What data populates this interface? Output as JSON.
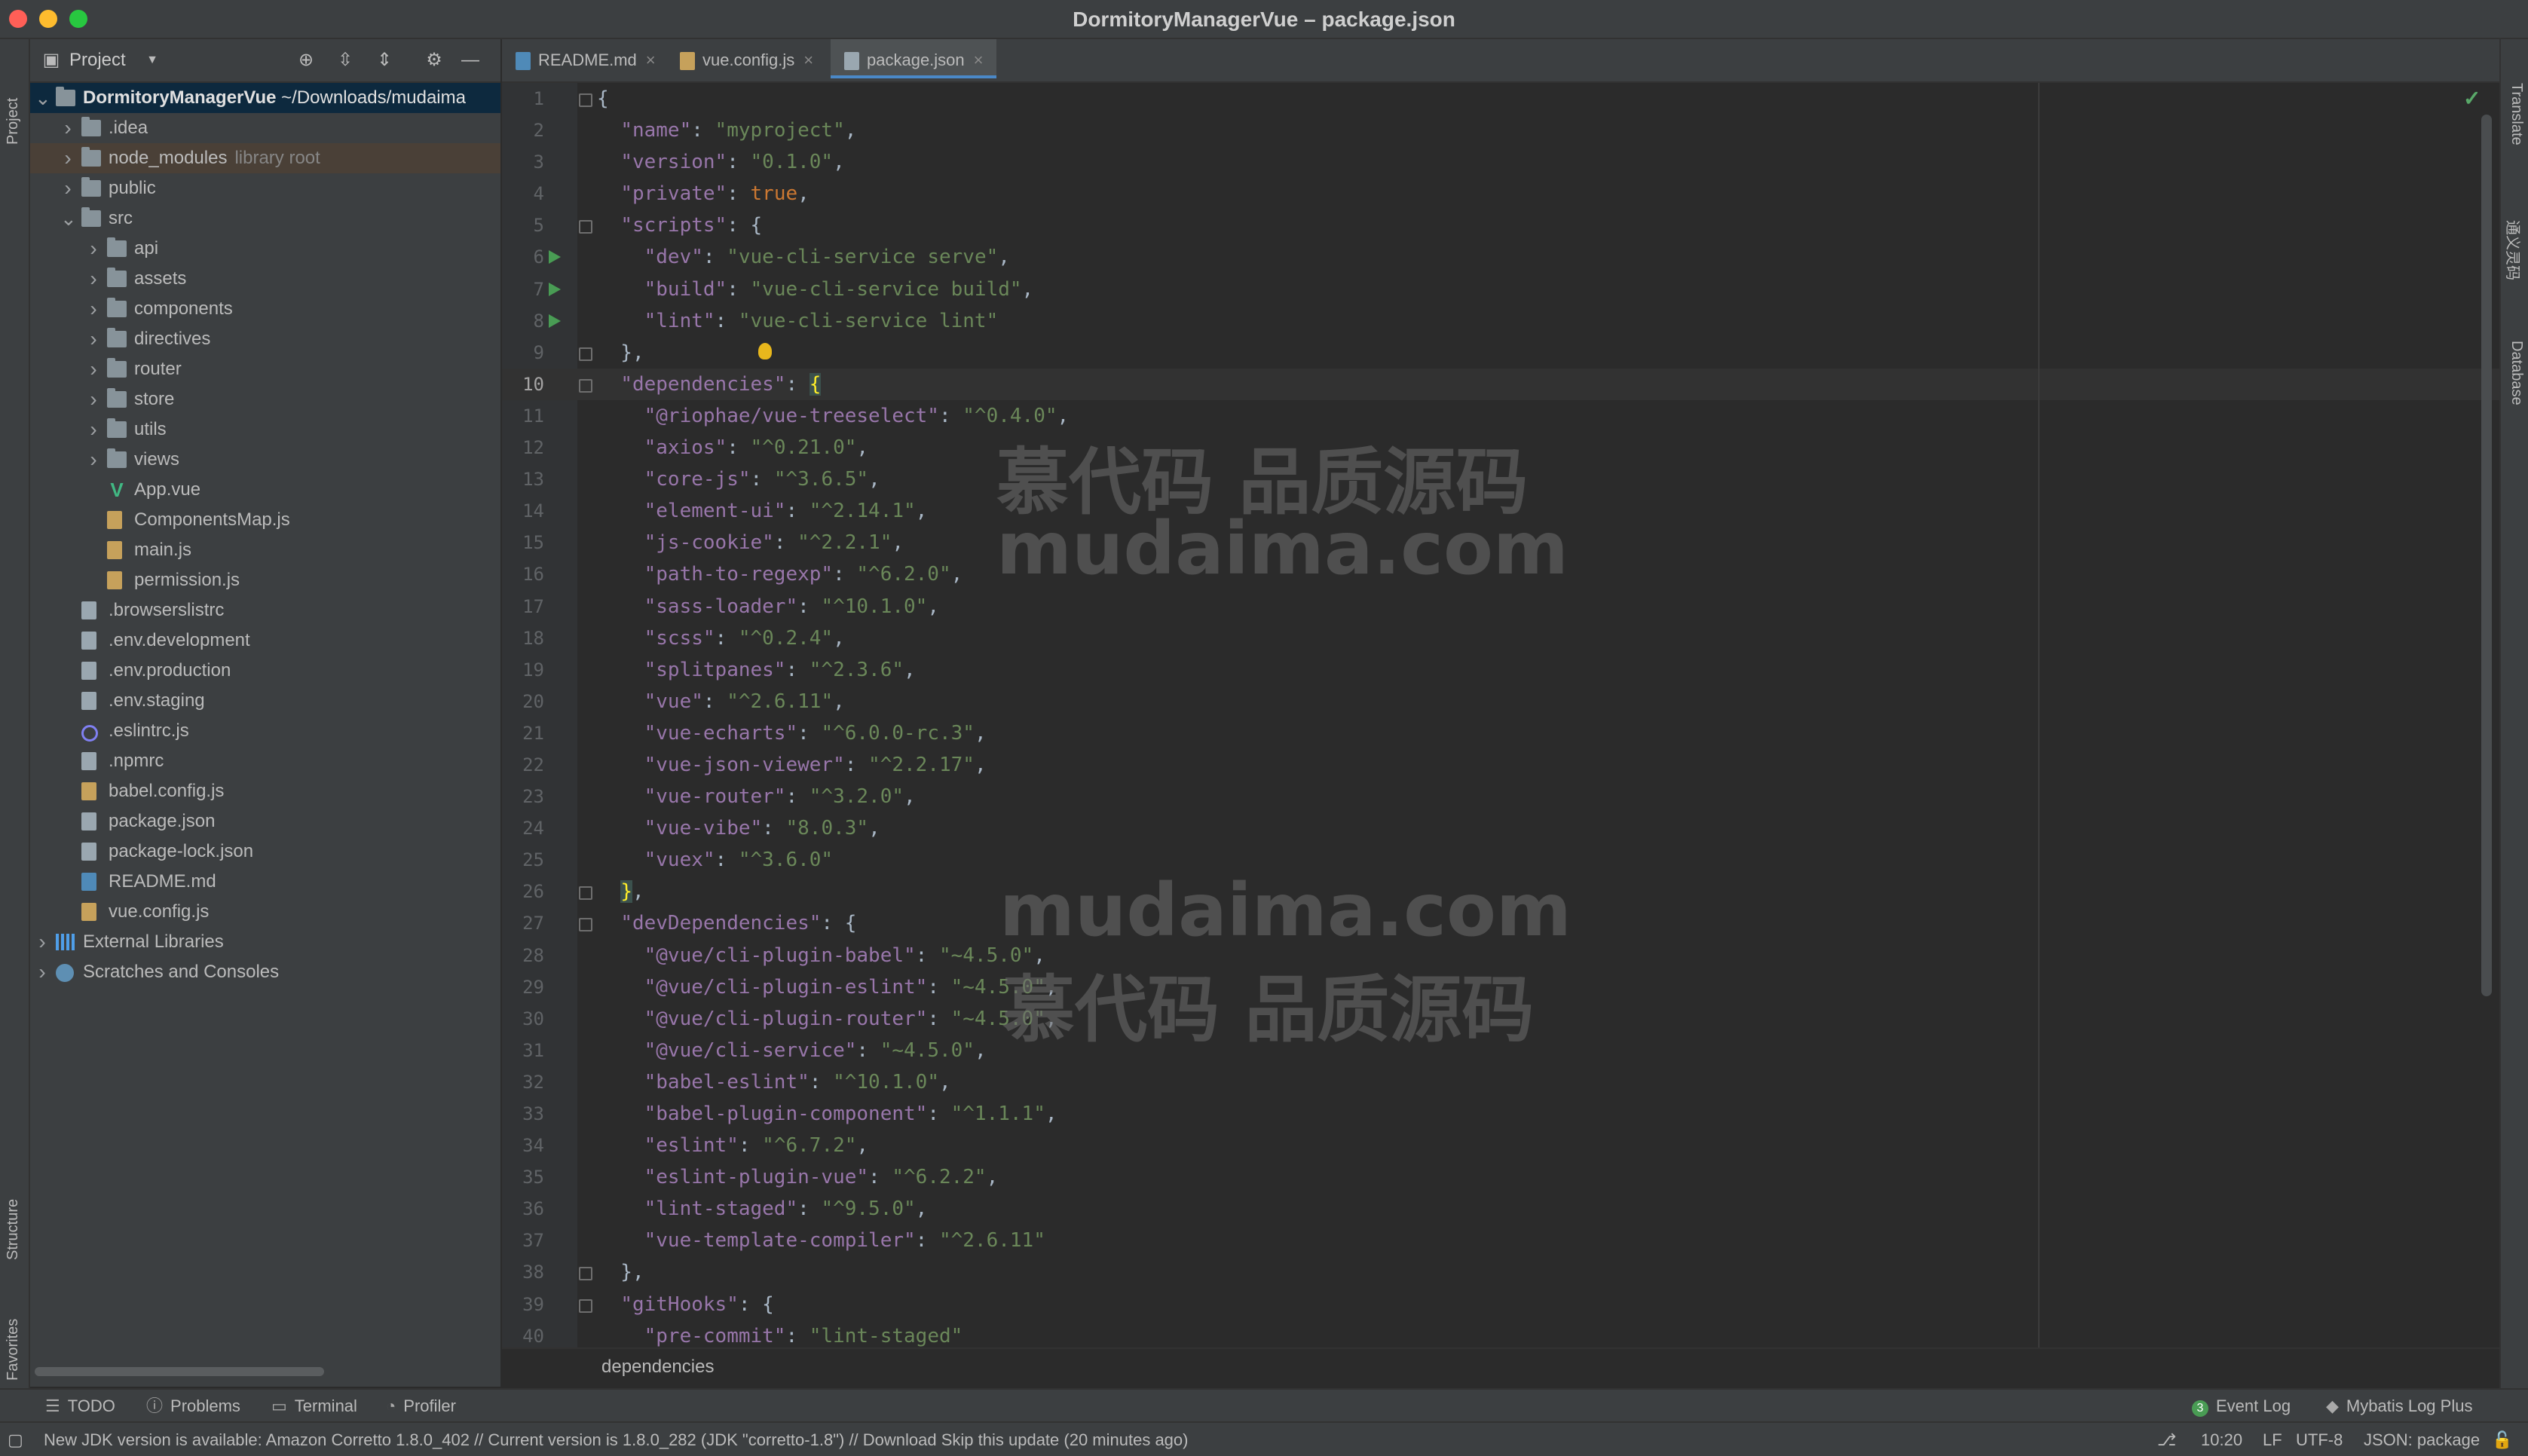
{
  "window": {
    "title": "DormitoryManagerVue – package.json"
  },
  "left_strip": {
    "project": "Project",
    "structure": "Structure",
    "favorites": "Favorites"
  },
  "right_strip": {
    "translate": "Translate",
    "tongyi": "通义灵码",
    "database": "Database"
  },
  "project_panel": {
    "title": "Project",
    "tree": [
      {
        "depth": 0,
        "arrow": "down",
        "icon": "folder",
        "name": "DormitoryManagerVue",
        "suffix": " ~/Downloads/mudaima",
        "bold": true,
        "selected": true
      },
      {
        "depth": 1,
        "arrow": "right",
        "icon": "folder",
        "name": ".idea"
      },
      {
        "depth": 1,
        "arrow": "right",
        "icon": "folder",
        "name": "node_modules",
        "suffix": "library root",
        "highlight": true
      },
      {
        "depth": 1,
        "arrow": "right",
        "icon": "folder",
        "name": "public"
      },
      {
        "depth": 1,
        "arrow": "down",
        "icon": "folder",
        "name": "src"
      },
      {
        "depth": 2,
        "arrow": "right",
        "icon": "folder",
        "name": "api"
      },
      {
        "depth": 2,
        "arrow": "right",
        "icon": "folder",
        "name": "assets"
      },
      {
        "depth": 2,
        "arrow": "right",
        "icon": "folder",
        "name": "components"
      },
      {
        "depth": 2,
        "arrow": "right",
        "icon": "folder",
        "name": "directives"
      },
      {
        "depth": 2,
        "arrow": "right",
        "icon": "folder",
        "name": "router"
      },
      {
        "depth": 2,
        "arrow": "right",
        "icon": "folder",
        "name": "store"
      },
      {
        "depth": 2,
        "arrow": "right",
        "icon": "folder",
        "name": "utils"
      },
      {
        "depth": 2,
        "arrow": "right",
        "icon": "folder",
        "name": "views"
      },
      {
        "depth": 2,
        "arrow": "none",
        "icon": "vue",
        "name": "App.vue"
      },
      {
        "depth": 2,
        "arrow": "none",
        "icon": "js",
        "name": "ComponentsMap.js"
      },
      {
        "depth": 2,
        "arrow": "none",
        "icon": "js",
        "name": "main.js"
      },
      {
        "depth": 2,
        "arrow": "none",
        "icon": "js",
        "name": "permission.js"
      },
      {
        "depth": 1,
        "arrow": "none",
        "icon": "file",
        "name": ".browserslistrc"
      },
      {
        "depth": 1,
        "arrow": "none",
        "icon": "file",
        "name": ".env.development"
      },
      {
        "depth": 1,
        "arrow": "none",
        "icon": "file",
        "name": ".env.production"
      },
      {
        "depth": 1,
        "arrow": "none",
        "icon": "file",
        "name": ".env.staging"
      },
      {
        "depth": 1,
        "arrow": "none",
        "icon": "eslint",
        "name": ".eslintrc.js"
      },
      {
        "depth": 1,
        "arrow": "none",
        "icon": "file",
        "name": ".npmrc"
      },
      {
        "depth": 1,
        "arrow": "none",
        "icon": "js",
        "name": "babel.config.js"
      },
      {
        "depth": 1,
        "arrow": "none",
        "icon": "file",
        "name": "package.json"
      },
      {
        "depth": 1,
        "arrow": "none",
        "icon": "file",
        "name": "package-lock.json"
      },
      {
        "depth": 1,
        "arrow": "none",
        "icon": "md",
        "name": "README.md"
      },
      {
        "depth": 1,
        "arrow": "none",
        "icon": "js",
        "name": "vue.config.js"
      },
      {
        "depth": 0,
        "arrow": "right",
        "icon": "lib",
        "name": "External Libraries"
      },
      {
        "depth": 0,
        "arrow": "right",
        "icon": "scratch",
        "name": "Scratches and Consoles"
      }
    ]
  },
  "tabs": [
    {
      "label": "README.md",
      "icon": "md",
      "active": false
    },
    {
      "label": "vue.config.js",
      "icon": "js",
      "active": false
    },
    {
      "label": "package.json",
      "icon": "file",
      "active": true
    }
  ],
  "editor": {
    "current_line": 10,
    "lines": [
      [
        [
          "p",
          "{"
        ]
      ],
      [
        [
          "p",
          "  "
        ],
        [
          "k",
          "\"name\""
        ],
        [
          "p",
          ": "
        ],
        [
          "s",
          "\"myproject\""
        ],
        [
          "p",
          ","
        ]
      ],
      [
        [
          "p",
          "  "
        ],
        [
          "k",
          "\"version\""
        ],
        [
          "p",
          ": "
        ],
        [
          "s",
          "\"0.1.0\""
        ],
        [
          "p",
          ","
        ]
      ],
      [
        [
          "p",
          "  "
        ],
        [
          "k",
          "\"private\""
        ],
        [
          "p",
          ": "
        ],
        [
          "w",
          "true"
        ],
        [
          "p",
          ","
        ]
      ],
      [
        [
          "p",
          "  "
        ],
        [
          "k",
          "\"scripts\""
        ],
        [
          "p",
          ": {"
        ]
      ],
      [
        [
          "p",
          "    "
        ],
        [
          "k",
          "\"dev\""
        ],
        [
          "p",
          ": "
        ],
        [
          "s",
          "\"vue-cli-service serve\""
        ],
        [
          "p",
          ","
        ]
      ],
      [
        [
          "p",
          "    "
        ],
        [
          "k",
          "\"build\""
        ],
        [
          "p",
          ": "
        ],
        [
          "s",
          "\"vue-cli-service build\""
        ],
        [
          "p",
          ","
        ]
      ],
      [
        [
          "p",
          "    "
        ],
        [
          "k",
          "\"lint\""
        ],
        [
          "p",
          ": "
        ],
        [
          "s",
          "\"vue-cli-service lint\""
        ]
      ],
      [
        [
          "p",
          "  },"
        ]
      ],
      [
        [
          "p",
          "  "
        ],
        [
          "k",
          "\"dependencies\""
        ],
        [
          "p",
          ": "
        ],
        [
          "h",
          "{"
        ]
      ],
      [
        [
          "p",
          "    "
        ],
        [
          "k",
          "\"@riophae/vue-treeselect\""
        ],
        [
          "p",
          ": "
        ],
        [
          "s",
          "\"^0.4.0\""
        ],
        [
          "p",
          ","
        ]
      ],
      [
        [
          "p",
          "    "
        ],
        [
          "k",
          "\"axios\""
        ],
        [
          "p",
          ": "
        ],
        [
          "s",
          "\"^0.21.0\""
        ],
        [
          "p",
          ","
        ]
      ],
      [
        [
          "p",
          "    "
        ],
        [
          "k",
          "\"core-js\""
        ],
        [
          "p",
          ": "
        ],
        [
          "s",
          "\"^3.6.5\""
        ],
        [
          "p",
          ","
        ]
      ],
      [
        [
          "p",
          "    "
        ],
        [
          "k",
          "\"element-ui\""
        ],
        [
          "p",
          ": "
        ],
        [
          "s",
          "\"^2.14.1\""
        ],
        [
          "p",
          ","
        ]
      ],
      [
        [
          "p",
          "    "
        ],
        [
          "k",
          "\"js-cookie\""
        ],
        [
          "p",
          ": "
        ],
        [
          "s",
          "\"^2.2.1\""
        ],
        [
          "p",
          ","
        ]
      ],
      [
        [
          "p",
          "    "
        ],
        [
          "k",
          "\"path-to-regexp\""
        ],
        [
          "p",
          ": "
        ],
        [
          "s",
          "\"^6.2.0\""
        ],
        [
          "p",
          ","
        ]
      ],
      [
        [
          "p",
          "    "
        ],
        [
          "k",
          "\"sass-loader\""
        ],
        [
          "p",
          ": "
        ],
        [
          "s",
          "\"^10.1.0\""
        ],
        [
          "p",
          ","
        ]
      ],
      [
        [
          "p",
          "    "
        ],
        [
          "k",
          "\"scss\""
        ],
        [
          "p",
          ": "
        ],
        [
          "s",
          "\"^0.2.4\""
        ],
        [
          "p",
          ","
        ]
      ],
      [
        [
          "p",
          "    "
        ],
        [
          "k",
          "\"splitpanes\""
        ],
        [
          "p",
          ": "
        ],
        [
          "s",
          "\"^2.3.6\""
        ],
        [
          "p",
          ","
        ]
      ],
      [
        [
          "p",
          "    "
        ],
        [
          "k",
          "\"vue\""
        ],
        [
          "p",
          ": "
        ],
        [
          "s",
          "\"^2.6.11\""
        ],
        [
          "p",
          ","
        ]
      ],
      [
        [
          "p",
          "    "
        ],
        [
          "k",
          "\"vue-echarts\""
        ],
        [
          "p",
          ": "
        ],
        [
          "s",
          "\"^6.0.0-rc.3\""
        ],
        [
          "p",
          ","
        ]
      ],
      [
        [
          "p",
          "    "
        ],
        [
          "k",
          "\"vue-json-viewer\""
        ],
        [
          "p",
          ": "
        ],
        [
          "s",
          "\"^2.2.17\""
        ],
        [
          "p",
          ","
        ]
      ],
      [
        [
          "p",
          "    "
        ],
        [
          "k",
          "\"vue-router\""
        ],
        [
          "p",
          ": "
        ],
        [
          "s",
          "\"^3.2.0\""
        ],
        [
          "p",
          ","
        ]
      ],
      [
        [
          "p",
          "    "
        ],
        [
          "k",
          "\"vue-vibe\""
        ],
        [
          "p",
          ": "
        ],
        [
          "s",
          "\"8.0.3\""
        ],
        [
          "p",
          ","
        ]
      ],
      [
        [
          "p",
          "    "
        ],
        [
          "k",
          "\"vuex\""
        ],
        [
          "p",
          ": "
        ],
        [
          "s",
          "\"^3.6.0\""
        ]
      ],
      [
        [
          "p",
          "  "
        ],
        [
          "h",
          "}"
        ],
        [
          "p",
          ","
        ]
      ],
      [
        [
          "p",
          "  "
        ],
        [
          "k",
          "\"devDependencies\""
        ],
        [
          "p",
          ": {"
        ]
      ],
      [
        [
          "p",
          "    "
        ],
        [
          "k",
          "\"@vue/cli-plugin-babel\""
        ],
        [
          "p",
          ": "
        ],
        [
          "s",
          "\"~4.5.0\""
        ],
        [
          "p",
          ","
        ]
      ],
      [
        [
          "p",
          "    "
        ],
        [
          "k",
          "\"@vue/cli-plugin-eslint\""
        ],
        [
          "p",
          ": "
        ],
        [
          "s",
          "\"~4.5.0\""
        ],
        [
          "p",
          ","
        ]
      ],
      [
        [
          "p",
          "    "
        ],
        [
          "k",
          "\"@vue/cli-plugin-router\""
        ],
        [
          "p",
          ": "
        ],
        [
          "s",
          "\"~4.5.0\""
        ],
        [
          "p",
          ","
        ]
      ],
      [
        [
          "p",
          "    "
        ],
        [
          "k",
          "\"@vue/cli-service\""
        ],
        [
          "p",
          ": "
        ],
        [
          "s",
          "\"~4.5.0\""
        ],
        [
          "p",
          ","
        ]
      ],
      [
        [
          "p",
          "    "
        ],
        [
          "k",
          "\"babel-eslint\""
        ],
        [
          "p",
          ": "
        ],
        [
          "s",
          "\"^10.1.0\""
        ],
        [
          "p",
          ","
        ]
      ],
      [
        [
          "p",
          "    "
        ],
        [
          "k",
          "\"babel-plugin-component\""
        ],
        [
          "p",
          ": "
        ],
        [
          "s",
          "\"^1.1.1\""
        ],
        [
          "p",
          ","
        ]
      ],
      [
        [
          "p",
          "    "
        ],
        [
          "k",
          "\"eslint\""
        ],
        [
          "p",
          ": "
        ],
        [
          "s",
          "\"^6.7.2\""
        ],
        [
          "p",
          ","
        ]
      ],
      [
        [
          "p",
          "    "
        ],
        [
          "k",
          "\"eslint-plugin-vue\""
        ],
        [
          "p",
          ": "
        ],
        [
          "s",
          "\"^6.2.2\""
        ],
        [
          "p",
          ","
        ]
      ],
      [
        [
          "p",
          "    "
        ],
        [
          "k",
          "\"lint-staged\""
        ],
        [
          "p",
          ": "
        ],
        [
          "s",
          "\"^9.5.0\""
        ],
        [
          "p",
          ","
        ]
      ],
      [
        [
          "p",
          "    "
        ],
        [
          "k",
          "\"vue-template-compiler\""
        ],
        [
          "p",
          ": "
        ],
        [
          "s",
          "\"^2.6.11\""
        ]
      ],
      [
        [
          "p",
          "  },"
        ]
      ],
      [
        [
          "p",
          "  "
        ],
        [
          "k",
          "\"gitHooks\""
        ],
        [
          "p",
          ": {"
        ]
      ],
      [
        [
          "p",
          "    "
        ],
        [
          "k",
          "\"pre-commit\""
        ],
        [
          "p",
          ": "
        ],
        [
          "s",
          "\"lint-staged\""
        ]
      ]
    ],
    "run_lines": [
      6,
      7,
      8
    ],
    "fold_lines": [
      1,
      5,
      9,
      10,
      26,
      27,
      38,
      39
    ],
    "bulb_line": 9,
    "breadcrumb": "dependencies"
  },
  "watermarks": {
    "a1": "慕代码 品质源码",
    "a2": "mudaima.com",
    "b1": "mudaima.com",
    "b2": "慕代码 品质源码"
  },
  "tool_windows": {
    "todo": "TODO",
    "problems": "Problems",
    "terminal": "Terminal",
    "profiler": "Profiler",
    "event_log_count": "3",
    "event_log": "Event Log",
    "mybatis": "Mybatis Log Plus"
  },
  "status": {
    "message": "New JDK version is available: Amazon Corretto 1.8.0_402 // Current version is 1.8.0_282 (JDK \"corretto-1.8\") // Download  Skip this update (20 minutes ago)",
    "position": "10:20",
    "line_sep": "LF",
    "encoding": "UTF-8",
    "schema": "JSON: package"
  }
}
